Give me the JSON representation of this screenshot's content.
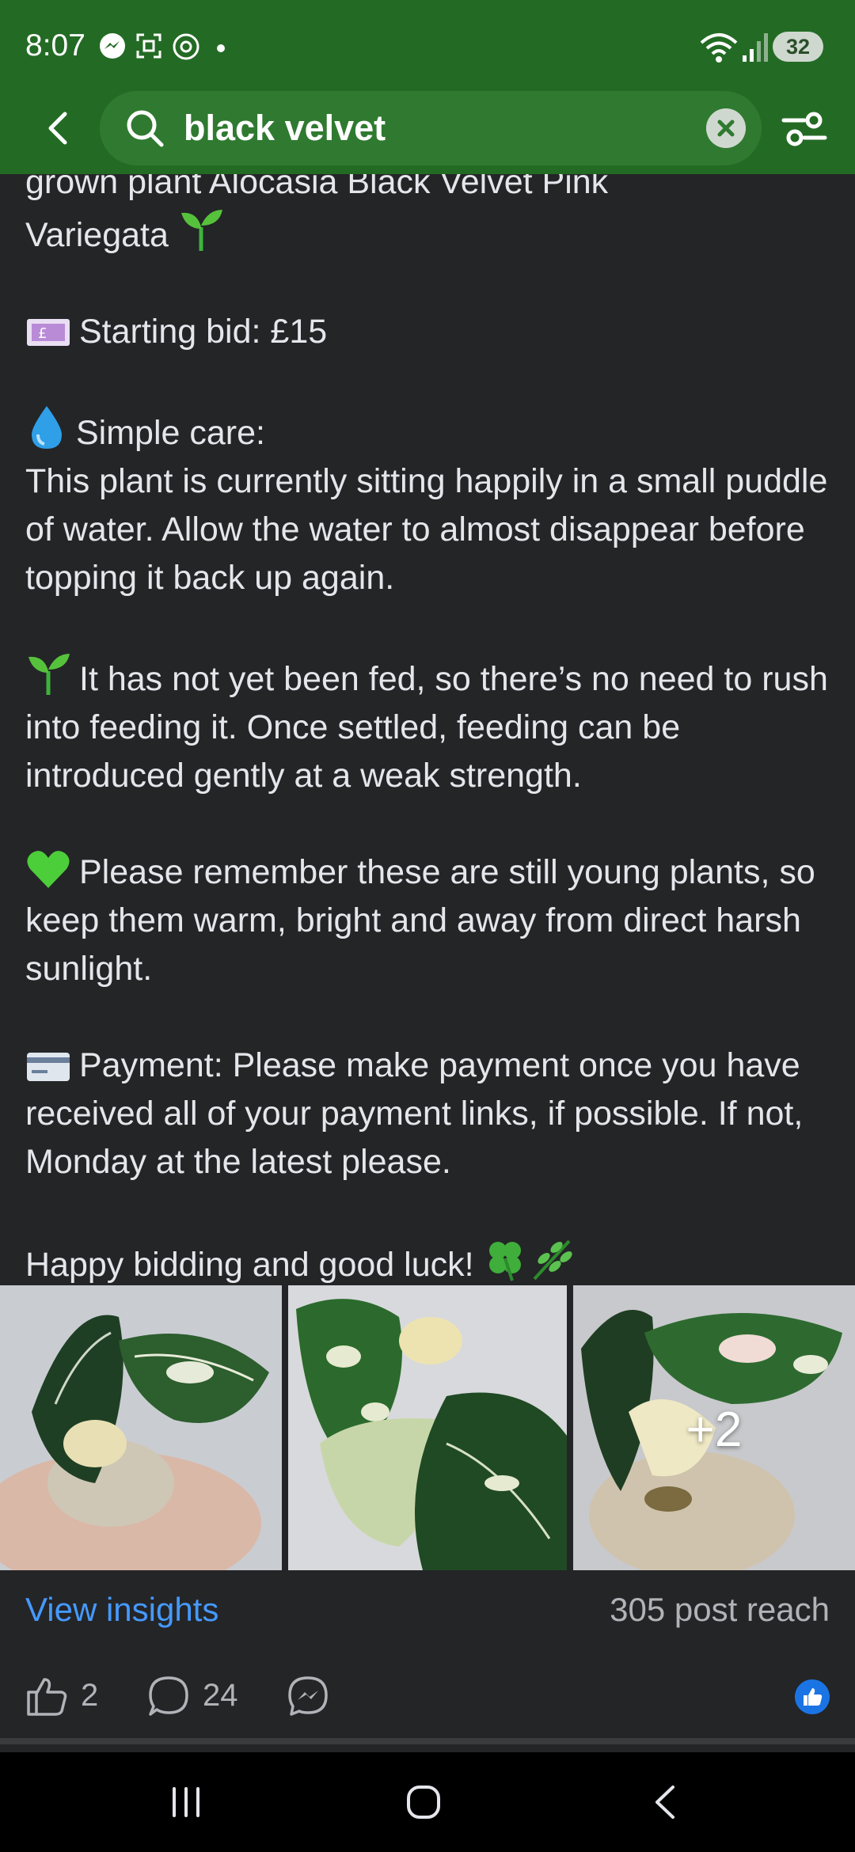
{
  "status_bar": {
    "time": "8:07",
    "battery": "32"
  },
  "header": {
    "search_query": "black velvet",
    "icons": [
      "back-arrow-icon",
      "search-icon",
      "clear-icon",
      "filter-icon"
    ]
  },
  "post": {
    "lines": [
      {
        "emoji": "",
        "text": "grown plant Alocasia Black Velvet Pink\nVariegata",
        "trailing_emoji": "seedling"
      },
      {
        "emoji": "money",
        "text": "Starting bid: £15"
      },
      {
        "emoji": "droplet",
        "text": "Simple care:\nThis plant is currently sitting happily in a small puddle of water. Allow the water to almost disappear before topping it back up again."
      },
      {
        "emoji": "seedling",
        "text": "It has not yet been fed, so there’s no need to rush into feeding it. Once settled, feeding can be introduced gently at a weak strength."
      },
      {
        "emoji": "green-heart",
        "text": "Please remember these are still young plants, so keep them warm, bright and away from direct harsh sunlight."
      },
      {
        "emoji": "credit-card",
        "text": "Payment: Please make payment once you have received all of your payment links, if possible. If not, Monday at the latest please."
      },
      {
        "emoji": "",
        "text": "Happy bidding and good luck!",
        "trailing_emoji": "clover-herb"
      }
    ],
    "more_photos": "+2"
  },
  "insights": {
    "view_label": "View insights",
    "reach": "305 post reach"
  },
  "actions": {
    "likes": "2",
    "comments": "24"
  },
  "colors": {
    "header_green": "#236b24",
    "link_blue": "#4599ff",
    "background": "#242527"
  }
}
